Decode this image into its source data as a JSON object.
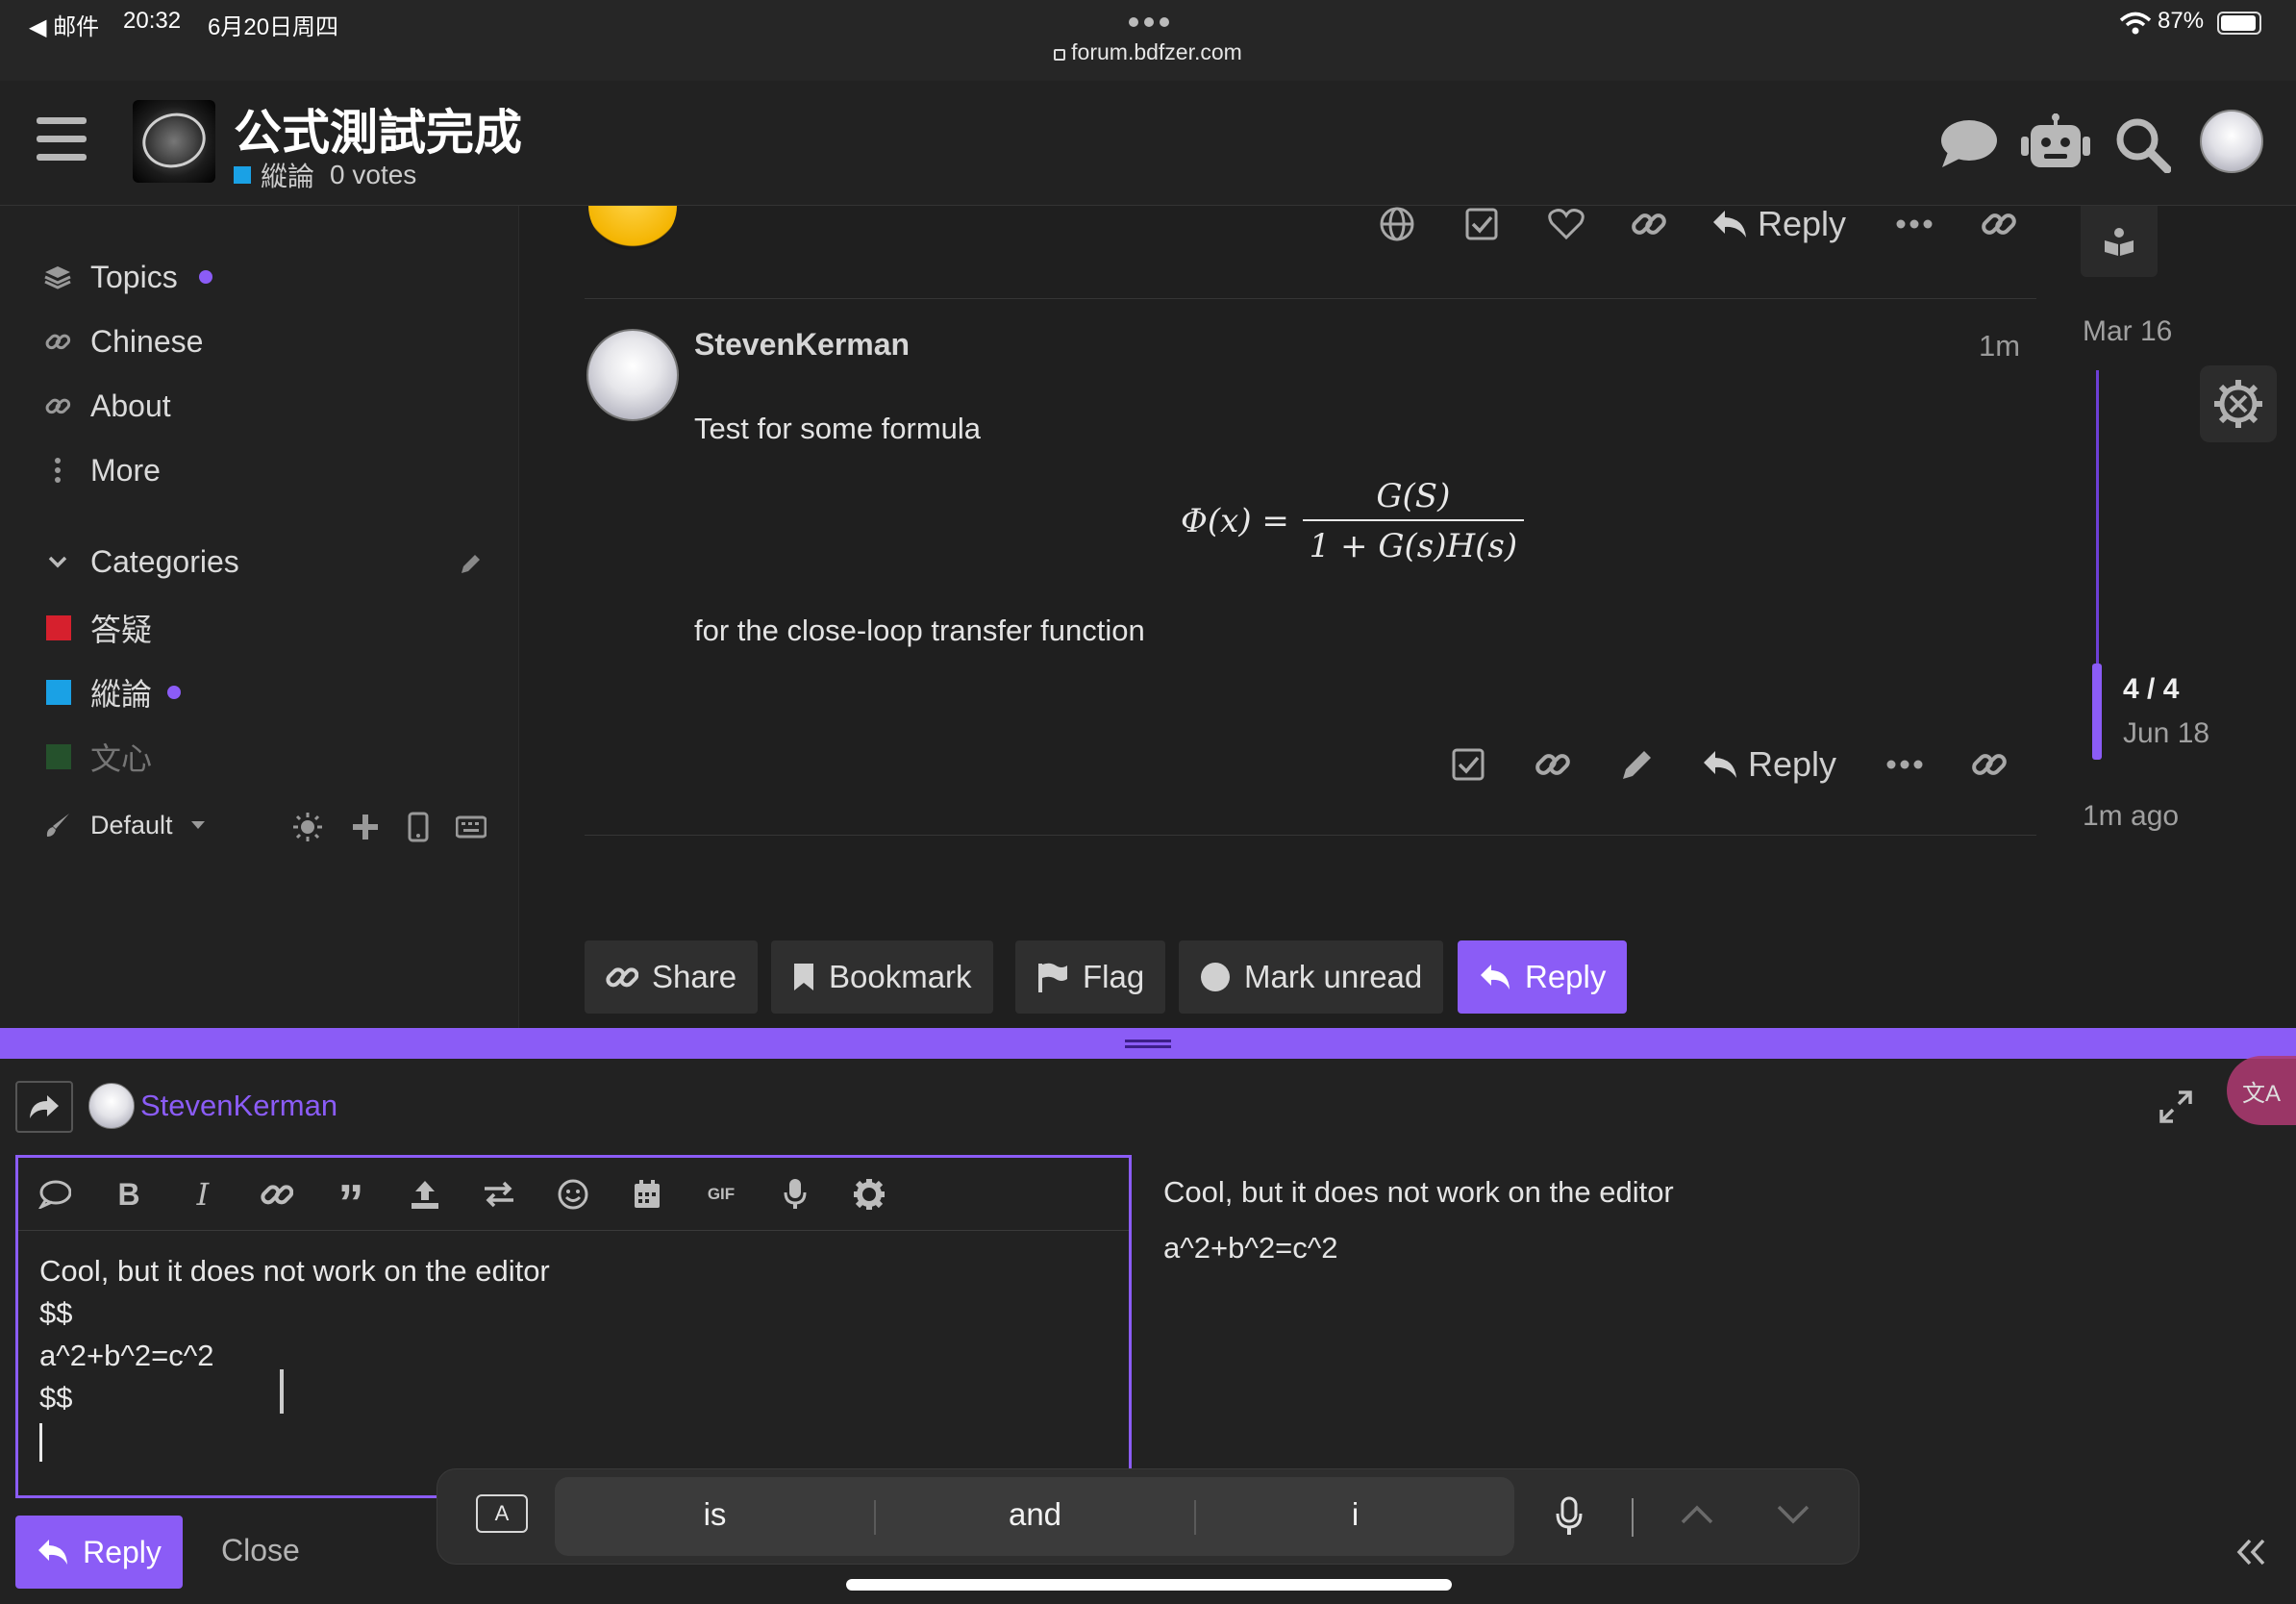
{
  "status_bar": {
    "back_app": "◀ 邮件",
    "time": "20:32",
    "date": "6月20日周四",
    "url": "forum.bdfzer.com",
    "battery": "87%"
  },
  "header": {
    "title": "公式測試完成",
    "category": "縱論",
    "votes": "0 votes"
  },
  "sidebar": {
    "items": [
      {
        "label": "Topics",
        "icon": "layers-icon"
      },
      {
        "label": "Chinese",
        "icon": "link-icon"
      },
      {
        "label": "About",
        "icon": "link-icon"
      },
      {
        "label": "More",
        "icon": "vertical-ellipsis-icon"
      }
    ],
    "categories_label": "Categories",
    "categories": [
      {
        "label": "答疑",
        "color": "#d6202d"
      },
      {
        "label": "縱論",
        "color": "#1aa1e5"
      },
      {
        "label": "文心",
        "color": "#2a8a3a"
      }
    ],
    "theme_label": "Default"
  },
  "posts": {
    "reply_label": "Reply",
    "post": {
      "author": "StevenKerman",
      "age": "1m",
      "line1": "Test for some formula",
      "line2": "for the close-loop transfer function",
      "formula_lhs": "Φ(x) =",
      "formula_num": "G(S)",
      "formula_den": "1 + G(s)H(s)"
    }
  },
  "timeline": {
    "start": "Mar 16",
    "position": "4 / 4",
    "current_date": "Jun 18",
    "ago": "1m ago"
  },
  "footer_buttons": {
    "share": "Share",
    "bookmark": "Bookmark",
    "flag": "Flag",
    "mark_unread": "Mark unread",
    "reply": "Reply"
  },
  "composer": {
    "user": "StevenKerman",
    "editor_lines": [
      "Cool, but it does not work on the editor",
      "$$",
      "a^2+b^2=c^2",
      "$$"
    ],
    "preview_lines": [
      "Cool, but it does not work on the editor",
      "a^2+b^2=c^2"
    ],
    "reply_button": "Reply",
    "close_button": "Close",
    "gif_label": "GIF"
  },
  "keyboard": {
    "suggestions": [
      "is",
      "and",
      "i"
    ],
    "mode_key": "A"
  },
  "colors": {
    "accent": "#8b5cf6",
    "background": "#1f1f1f"
  }
}
